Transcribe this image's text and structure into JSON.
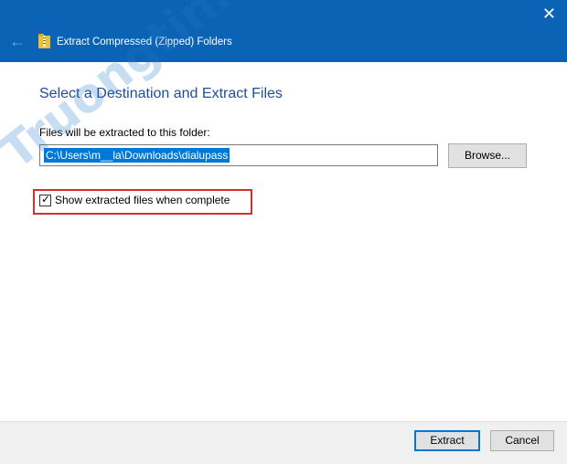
{
  "window": {
    "title": "Extract Compressed (Zipped) Folders",
    "close_glyph": "✕",
    "back_glyph": "←",
    "titlebar_color": "#0b63b6"
  },
  "content": {
    "heading": "Select a Destination and Extract Files",
    "path_label": "Files will be extracted to this folder:",
    "path_value": "C:\\Users\\m__la\\Downloads\\dialupass",
    "browse_label": "Browse...",
    "checkbox_label": "Show extracted files when complete",
    "checkbox_checked": true,
    "highlight_color": "#d32f2f"
  },
  "footer": {
    "extract_label": "Extract",
    "cancel_label": "Cancel"
  },
  "watermark": {
    "text": "Truongtin.top"
  },
  "icons": {
    "back": "back-arrow-icon",
    "zip": "zip-folder-icon",
    "close": "close-icon",
    "check": "checkmark-icon"
  }
}
